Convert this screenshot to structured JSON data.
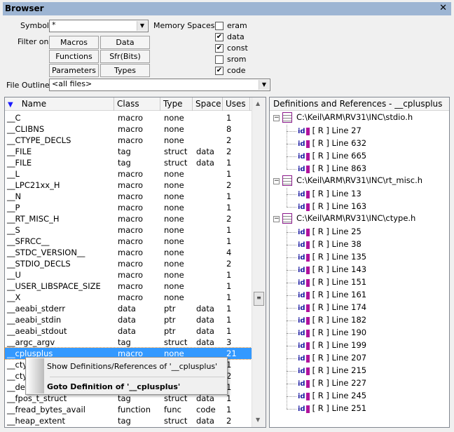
{
  "window": {
    "title": "Browser",
    "close": "✕"
  },
  "filters": {
    "symbol_label": "Symbol:",
    "symbol_value": "*",
    "filter_label": "Filter on:",
    "buttons": [
      "Macros",
      "Data",
      "Functions",
      "Sfr(Bits)",
      "Parameters",
      "Types"
    ],
    "memory_label": "Memory Spaces:",
    "memory": [
      {
        "label": "eram",
        "checked": false
      },
      {
        "label": "data",
        "checked": true
      },
      {
        "label": "const",
        "checked": true
      },
      {
        "label": "srom",
        "checked": false
      },
      {
        "label": "code",
        "checked": true
      }
    ],
    "file_outline_label": "File Outline:",
    "file_outline_value": "<all files>"
  },
  "table": {
    "columns": [
      "Name",
      "Class",
      "Type",
      "Space",
      "Uses"
    ],
    "selected_index": 21,
    "rows": [
      [
        "__C",
        "macro",
        "none",
        "",
        "1"
      ],
      [
        "__CLIBNS",
        "macro",
        "none",
        "",
        "8"
      ],
      [
        "__CTYPE_DECLS",
        "macro",
        "none",
        "",
        "2"
      ],
      [
        "__FILE",
        "tag",
        "struct",
        "data",
        "2"
      ],
      [
        "__FILE",
        "tag",
        "struct",
        "data",
        "1"
      ],
      [
        "__L",
        "macro",
        "none",
        "",
        "1"
      ],
      [
        "__LPC21xx_H",
        "macro",
        "none",
        "",
        "2"
      ],
      [
        "__N",
        "macro",
        "none",
        "",
        "1"
      ],
      [
        "__P",
        "macro",
        "none",
        "",
        "1"
      ],
      [
        "__RT_MISC_H",
        "macro",
        "none",
        "",
        "2"
      ],
      [
        "__S",
        "macro",
        "none",
        "",
        "1"
      ],
      [
        "__SFRCC__",
        "macro",
        "none",
        "",
        "1"
      ],
      [
        "__STDC_VERSION__",
        "macro",
        "none",
        "",
        "4"
      ],
      [
        "__STDIO_DECLS",
        "macro",
        "none",
        "",
        "2"
      ],
      [
        "__U",
        "macro",
        "none",
        "",
        "1"
      ],
      [
        "__USER_LIBSPACE_SIZE",
        "macro",
        "none",
        "",
        "1"
      ],
      [
        "__X",
        "macro",
        "none",
        "",
        "1"
      ],
      [
        "__aeabi_stderr",
        "data",
        "ptr",
        "data",
        "1"
      ],
      [
        "__aeabi_stdin",
        "data",
        "ptr",
        "data",
        "1"
      ],
      [
        "__aeabi_stdout",
        "data",
        "ptr",
        "data",
        "1"
      ],
      [
        "__argc_argv",
        "tag",
        "struct",
        "data",
        "3"
      ],
      [
        "__cplusplus",
        "macro",
        "none",
        "",
        "21"
      ],
      [
        "__cty",
        "",
        "",
        "",
        "1"
      ],
      [
        "__cty",
        "",
        "",
        "",
        "2"
      ],
      [
        "__def",
        "",
        "",
        "",
        "1"
      ],
      [
        "__fpos_t_struct",
        "tag",
        "struct",
        "data",
        "1"
      ],
      [
        "__fread_bytes_avail",
        "function",
        "func",
        "code",
        "1"
      ],
      [
        "__heap_extent",
        "tag",
        "struct",
        "data",
        "2"
      ]
    ]
  },
  "refs": {
    "title": "Definitions and References - __cplusplus",
    "files": [
      {
        "path": "C:\\Keil\\ARM\\RV31\\INC\\stdio.h",
        "items": [
          "[ R ] Line 27",
          "[ R ] Line 632",
          "[ R ] Line 665",
          "[ R ] Line 863"
        ]
      },
      {
        "path": "C:\\Keil\\ARM\\RV31\\INC\\rt_misc.h",
        "items": [
          "[ R ] Line 13",
          "[ R ] Line 163"
        ]
      },
      {
        "path": "C:\\Keil\\ARM\\RV31\\INC\\ctype.h",
        "items": [
          "[ R ] Line 25",
          "[ R ] Line 38",
          "[ R ] Line 135",
          "[ R ] Line 143",
          "[ R ] Line 151",
          "[ R ] Line 161",
          "[ R ] Line 174",
          "[ R ] Line 182",
          "[ R ] Line 190",
          "[ R ] Line 199",
          "[ R ] Line 207",
          "[ R ] Line 215",
          "[ R ] Line 227",
          "[ R ] Line 245",
          "[ R ] Line 251"
        ]
      }
    ]
  },
  "context_menu": {
    "items": [
      "Show Definitions/References of '__cplusplus'",
      "Goto Definition of '__cplusplus'"
    ]
  },
  "colors": {
    "title_bar": "#9db5d3",
    "selection": "#3399ff",
    "icon_accent": "#b0139c"
  }
}
